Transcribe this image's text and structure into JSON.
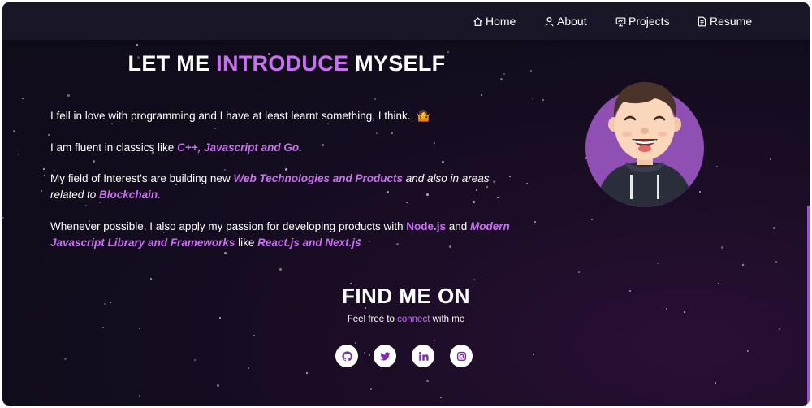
{
  "nav": {
    "items": [
      {
        "label": "Home",
        "icon": "home-icon"
      },
      {
        "label": "About",
        "icon": "user-icon"
      },
      {
        "label": "Projects",
        "icon": "projects-icon"
      },
      {
        "label": "Resume",
        "icon": "document-icon"
      }
    ]
  },
  "about": {
    "headline": {
      "part1": "LET ME ",
      "highlight": "INTRODUCE",
      "part2": " MYSELF"
    },
    "p1": {
      "text": "I fell in love with programming and I have at least learnt something, I think.. ",
      "emoji": "🤷"
    },
    "p2": {
      "text": "I am fluent in classics like ",
      "highlight": "C++, Javascript and Go."
    },
    "p3": {
      "text1": "My field of Interest's are building new ",
      "highlight1": " Web Technologies and Products",
      "text2": " and also in areas related to ",
      "highlight2": "Blockchain."
    },
    "p4": {
      "text1": "Whenever possible, I also apply my passion for developing products with ",
      "highlight1": "Node.js",
      "text2": " and ",
      "highlight2": "Modern Javascript Library and Frameworks",
      "text3": "  like ",
      "highlight3": "React.js and Next.js"
    }
  },
  "find": {
    "title": "FIND ME ON",
    "sub_text1": "Feel free to ",
    "sub_link": "connect",
    "sub_text2": " with me",
    "socials": [
      "github-icon",
      "twitter-icon",
      "linkedin-icon",
      "instagram-icon"
    ]
  },
  "colors": {
    "accent": "#c770f0",
    "background": "#110c1c",
    "navbar": "#191627"
  }
}
